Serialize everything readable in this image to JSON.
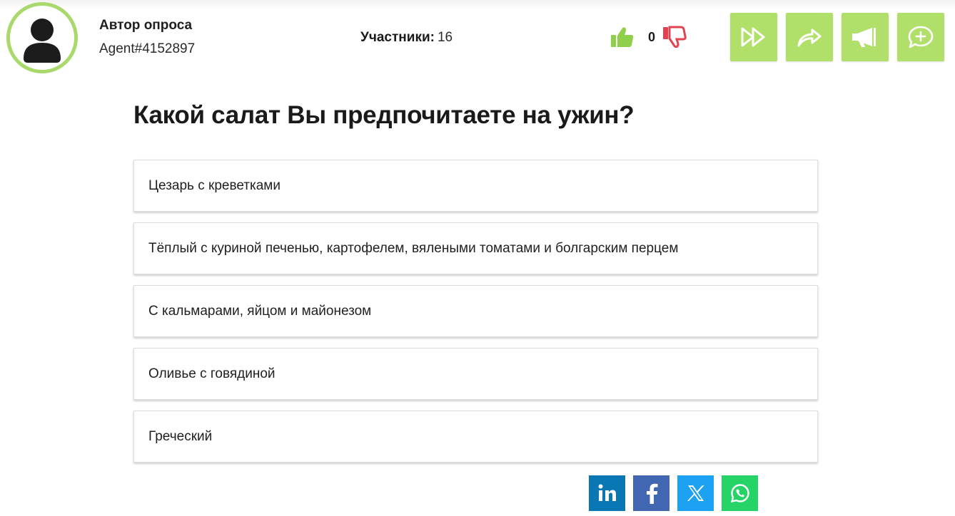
{
  "header": {
    "author_label": "Автор опроса",
    "author_name": "Agent#4152897",
    "participants_label": "Участники:",
    "participants_count": "16",
    "vote_score": "0",
    "actions": [
      {
        "name": "skip",
        "icon": "fast-forward-icon"
      },
      {
        "name": "share",
        "icon": "share-arrow-icon"
      },
      {
        "name": "promote",
        "icon": "megaphone-icon"
      },
      {
        "name": "add-comment",
        "icon": "comment-plus-icon"
      }
    ]
  },
  "poll": {
    "question": "Какой салат Вы предпочитаете на ужин?",
    "options": [
      "Цезарь с креветками",
      "Тёплый с куриной печенью, картофелем, вялеными томатами и болгарским перцем",
      "С кальмарами, яйцом и майонезом",
      "Оливье с говядиной",
      "Греческий"
    ]
  },
  "share": [
    {
      "name": "linkedin",
      "icon": "linkedin-icon",
      "color": "#0a77b5"
    },
    {
      "name": "facebook",
      "icon": "facebook-icon",
      "color": "#4267b2"
    },
    {
      "name": "x",
      "icon": "x-icon",
      "color": "#1da1f2"
    },
    {
      "name": "whatsapp",
      "icon": "whatsapp-icon",
      "color": "#25d366"
    }
  ],
  "colors": {
    "accent": "#b1e06a",
    "like": "#8fcf4a",
    "dislike": "#e0424f",
    "avatar_ring": "#a8d96a"
  }
}
